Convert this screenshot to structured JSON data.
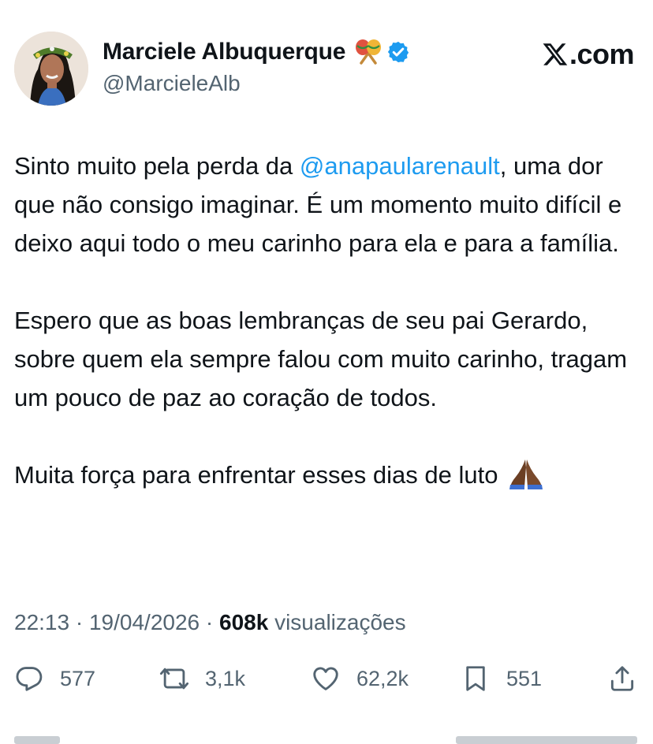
{
  "brand": {
    "logo_text": ".com",
    "x_color": "#0f1419"
  },
  "author": {
    "display_name": "Marciele Albuquerque",
    "handle": "@MarcieleAlb",
    "verified": true,
    "verified_color": "#1d9bf0",
    "badge_icon": "maracas-icon"
  },
  "tweet": {
    "para1_prefix": "Sinto muito pela perda da ",
    "mention": "@anapaularenault",
    "para1_suffix": ", uma dor que não consigo imaginar. É um momento muito difícil e deixo aqui todo o meu carinho para ela e para a família.",
    "para2": "Espero que as boas lembranças de seu pai Gerardo, sobre quem ela sempre falou com muito carinho, tragam um pouco de paz ao coração de todos.",
    "para3": "Muita força para enfrentar esses dias de luto",
    "emoji_icon": "folded-hands-icon",
    "mention_color": "#1d9bf0"
  },
  "meta": {
    "time": "22:13",
    "sep1": " · ",
    "date": "19/04/2026",
    "sep2": " · ",
    "views_count": "608k",
    "views_label": " visualizações"
  },
  "actions": {
    "replies": "577",
    "reposts": "3,1k",
    "likes": "62,2k",
    "bookmarks": "551"
  }
}
